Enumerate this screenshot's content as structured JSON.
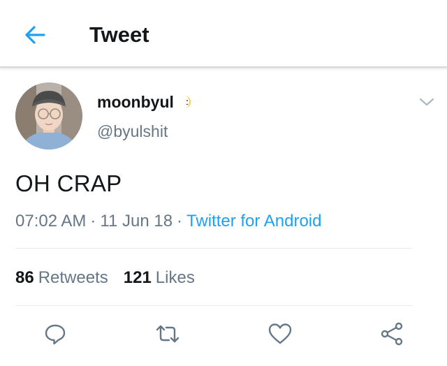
{
  "header": {
    "title": "Tweet",
    "back_icon": "arrow-left-icon",
    "accent_color": "#1da1f2"
  },
  "tweet": {
    "author": {
      "display_name": "moonbyul",
      "name_emoji_icon": "crescent-moon-icon",
      "handle": "@byulshit"
    },
    "text": "OH CRAP",
    "time": "07:02 AM",
    "separator": "·",
    "date": "11 Jun 18",
    "source": "Twitter for Android",
    "menu_icon": "chevron-down-icon"
  },
  "stats": {
    "retweets_count": "86",
    "retweets_label": "Retweets",
    "likes_count": "121",
    "likes_label": "Likes"
  },
  "actions": [
    {
      "name": "reply",
      "icon": "reply-icon"
    },
    {
      "name": "retweet",
      "icon": "retweet-icon"
    },
    {
      "name": "like",
      "icon": "heart-icon"
    },
    {
      "name": "share",
      "icon": "share-icon"
    }
  ],
  "colors": {
    "text_primary": "#14171a",
    "text_secondary": "#657786",
    "link": "#1da1f2",
    "divider": "#e6ecf0"
  }
}
